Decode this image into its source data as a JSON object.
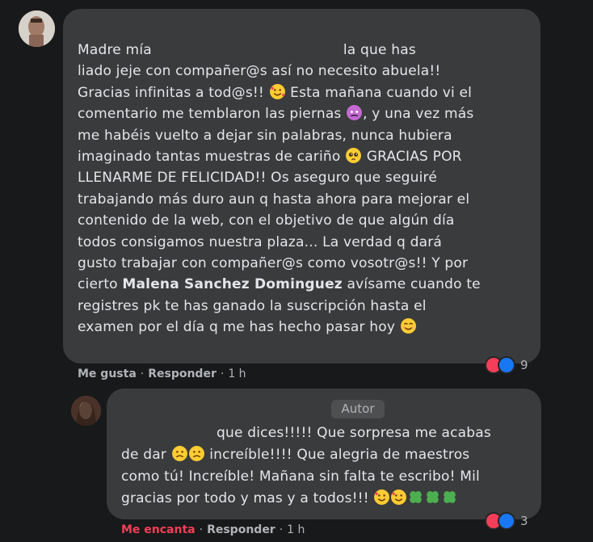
{
  "comment": {
    "parts": {
      "p1": "Madre mía",
      "p2": "la que has\nliado jeje con compañer@s así no necesito abuela!!\nGracias infinitas a tod@s!! ",
      "p3": " Esta mañana cuando vi el\ncomentario me temblaron las piernas ",
      "p4": ", y una vez más\nme habéis vuelto a dejar sin palabras, nunca hubiera\nimaginado tantas muestras de cariño ",
      "p5": " GRACIAS POR\nLLENARME DE FELICIDAD!! Os aseguro que seguiré\ntrabajando más duro aun q hasta ahora para mejorar el\ncontenido de la web, con el objetivo de que algún día\ntodos consigamos nuestra plaza... La verdad q dará\ngusto trabajar con compañer@s como vosotr@s!! Y por\ncierto ",
      "mention": "Malena Sanchez Dominguez",
      "p6": " avísame cuando te\nregistres pk te has ganado la suscripción hasta el\nexamen por el día q me has hecho pasar hoy "
    },
    "actions": {
      "like": "Me gusta",
      "reply": "Responder",
      "time": "1 h"
    },
    "reaction_count": "9"
  },
  "reply": {
    "author_badge": "Autor",
    "parts": {
      "r1": "que dices!!!!! Que sorpresa me acabas\nde dar ",
      "r2": " increíble!!!! Que alegria de maestros\ncomo tú! Increíble! Mañana sin falta te escribo! Mil\ngracias por todo y mas y a todos!!! "
    },
    "actions": {
      "like": "Me encanta",
      "reply": "Responder",
      "time": "1 h"
    },
    "reaction_count": "3"
  },
  "colors": {
    "background": "#18191a",
    "bubble": "#3a3b3c",
    "text": "#e4e6eb",
    "muted": "#b0b3b8",
    "love": "#f33e58",
    "like": "#1877f2"
  },
  "icons": [
    "smiling-face-with-hearts-icon",
    "woozy-face-icon",
    "pleading-face-icon",
    "smiling-face-icon",
    "frowning-face-icon",
    "four-leaf-clover-icon",
    "heart-reaction-icon",
    "like-reaction-icon"
  ]
}
